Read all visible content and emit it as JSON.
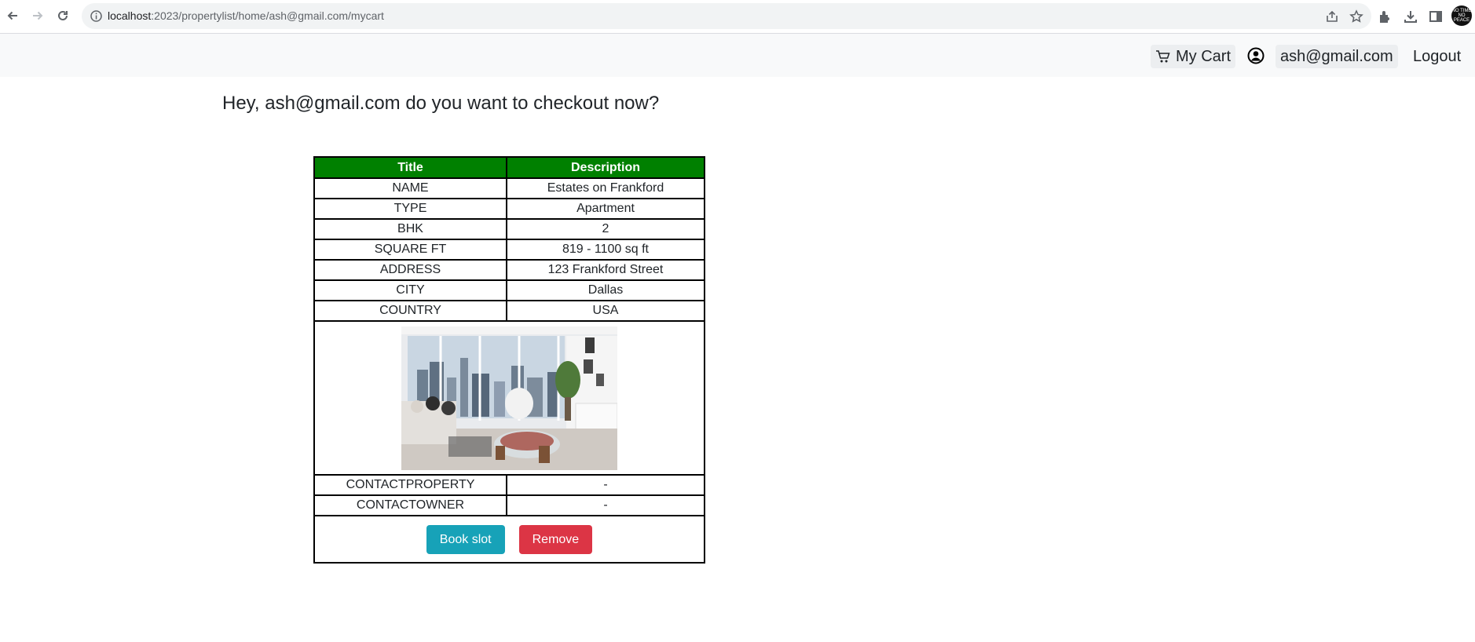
{
  "browser": {
    "url_host": "localhost",
    "url_rest": ":2023/propertylist/home/ash@gmail.com/mycart",
    "profile_text": "NO TIME NO PEACE"
  },
  "navbar": {
    "cart_label": "My Cart",
    "user_email": "ash@gmail.com",
    "logout_label": "Logout"
  },
  "greeting": "Hey, ash@gmail.com do you want to checkout now?",
  "table": {
    "headers": [
      "Title",
      "Description"
    ],
    "rows": [
      {
        "label": "NAME",
        "value": "Estates on Frankford"
      },
      {
        "label": "TYPE",
        "value": "Apartment"
      },
      {
        "label": "BHK",
        "value": "2"
      },
      {
        "label": "SQUARE FT",
        "value": "819 - 1100 sq ft"
      },
      {
        "label": "ADDRESS",
        "value": "123 Frankford Street"
      },
      {
        "label": "CITY",
        "value": "Dallas"
      },
      {
        "label": "COUNTRY",
        "value": "USA"
      }
    ],
    "contact_rows": [
      {
        "label": "CONTACTPROPERTY",
        "value": "-"
      },
      {
        "label": "CONTACTOWNER",
        "value": "-"
      }
    ],
    "book_label": "Book slot",
    "remove_label": "Remove"
  },
  "colors": {
    "header_green": "#008000",
    "book_button": "#17a2b8",
    "remove_button": "#dc3545"
  }
}
